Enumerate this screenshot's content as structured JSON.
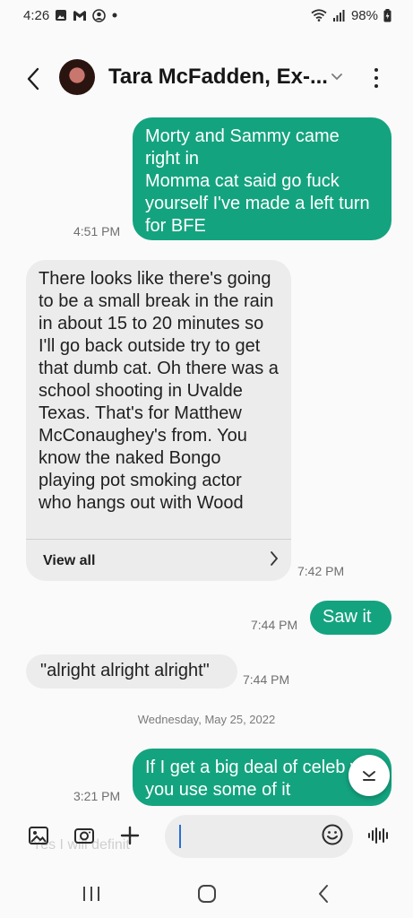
{
  "status_bar": {
    "time": "4:26",
    "battery": "98%",
    "icons": [
      "gallery-icon",
      "gmail-icon",
      "face-icon",
      "dot-icon",
      "wifi-icon",
      "signal-icon",
      "battery-icon"
    ]
  },
  "header": {
    "contact_name": "Tara McFadden, Ex-...",
    "icons": [
      "back-arrow-icon",
      "chevron-down-icon",
      "more-vert-icon"
    ]
  },
  "messages": [
    {
      "type": "sent",
      "text": "Morty and Sammy came right in\nMomma cat said go fuck yourself I've made a left turn for BFE",
      "time": "4:51 PM"
    },
    {
      "type": "received",
      "text": "There looks like there's going to be a small break in the rain in about 15 to 20 minutes so I'll go back outside try to get that dumb cat. Oh there was a school shooting in Uvalde Texas. That's for Matthew McConaughey's from. You know the naked Bongo playing pot smoking actor who hangs out with Wood",
      "time": "7:42 PM",
      "view_all": "View all"
    },
    {
      "type": "sent",
      "text": "Saw it",
      "time": "7:44 PM"
    },
    {
      "type": "received",
      "text": "\"alright alright alright\"",
      "time": "7:44 PM"
    },
    {
      "type": "sent",
      "text": "If I get a big deal of celeb will you use some of it",
      "time": "3:21 PM"
    }
  ],
  "date_separator": "Wednesday, May 25, 2022",
  "composer": {
    "ghost_text": "Yes I will definit",
    "icons": [
      "gallery-icon",
      "camera-icon",
      "plus-icon",
      "emoji-icon",
      "voice-icon"
    ]
  },
  "nav_bar": {
    "icons": [
      "recents-icon",
      "home-icon",
      "back-icon"
    ]
  },
  "colors": {
    "sent_bubble": "#14a37f",
    "received_bubble": "#ececec",
    "background": "#fafafa"
  }
}
